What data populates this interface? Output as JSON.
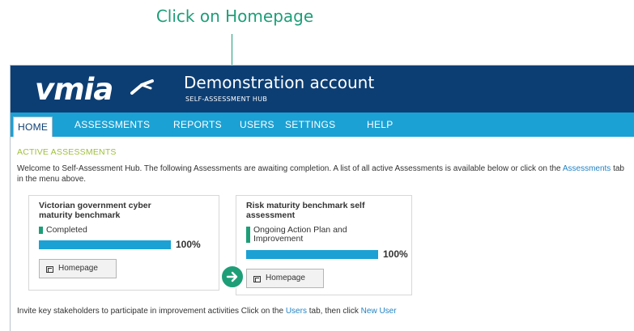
{
  "callout": {
    "text": "Click on Homepage"
  },
  "header": {
    "logo_text": "vmia",
    "account_title": "Demonstration account",
    "hub_name": "SELF-ASSESSMENT HUB"
  },
  "nav": {
    "tabs": [
      {
        "label": "HOME",
        "active": true
      },
      {
        "label": "ASSESSMENTS"
      },
      {
        "label": "REPORTS"
      },
      {
        "label": "USERS"
      },
      {
        "label": "SETTINGS"
      },
      {
        "label": "HELP"
      }
    ]
  },
  "main": {
    "section_title": "ACTIVE ASSESSMENTS",
    "intro_before_link": "Welcome to Self-Assessment Hub. The following Assessments are awaiting completion. A list of all active Assessments is available below or click on the ",
    "intro_link": "Assessments",
    "intro_after_link": " tab in the menu above.",
    "cards": [
      {
        "title_line1": "Victorian government cyber",
        "title_line2": "maturity benchmark",
        "status_line1": "Completed",
        "status_line2": "",
        "progress_percent": 100,
        "progress_label": "100%",
        "button_label": "Homepage"
      },
      {
        "title_line1": "Risk maturity benchmark self",
        "title_line2": "assessment",
        "status_line1": "Ongoing Action Plan and",
        "status_line2": "Improvement",
        "progress_percent": 100,
        "progress_label": "100%",
        "button_label": "Homepage"
      }
    ],
    "footer_before_users": "Invite key stakeholders to participate in improvement activities Click on the ",
    "footer_users_link": "Users",
    "footer_middle": " tab, then click ",
    "footer_new_user_link": "New User"
  },
  "colors": {
    "header_bg": "#0d3e73",
    "nav_bg": "#1ba1d4",
    "accent_green": "#1e9e77",
    "section_title": "#9fbf3d",
    "link": "#2383c4"
  },
  "icons": [
    "arrow-right-icon",
    "homepage-icon",
    "vmia-logo-mark"
  ]
}
